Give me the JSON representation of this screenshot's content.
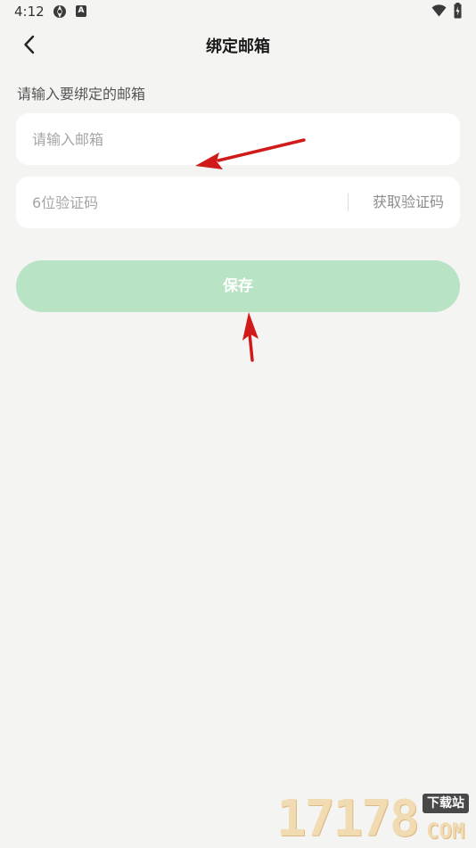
{
  "status_bar": {
    "time": "4:12",
    "badge_letter": "A"
  },
  "header": {
    "title": "绑定邮箱"
  },
  "form": {
    "section_label": "请输入要绑定的邮箱",
    "email_placeholder": "请输入邮箱",
    "email_value": "",
    "code_placeholder": "6位验证码",
    "code_value": "",
    "get_code_label": "获取验证码",
    "save_label": "保存"
  },
  "watermark": {
    "digits": "17178",
    "badge": "下载站",
    "domain": "COM"
  },
  "colors": {
    "background": "#f4f5f2",
    "save_button": "#b8e3c4",
    "annotation_arrow": "#d11a1a"
  },
  "icons": {
    "back": "chevron-left-icon",
    "wifi": "wifi-icon",
    "battery": "battery-charging-icon"
  }
}
